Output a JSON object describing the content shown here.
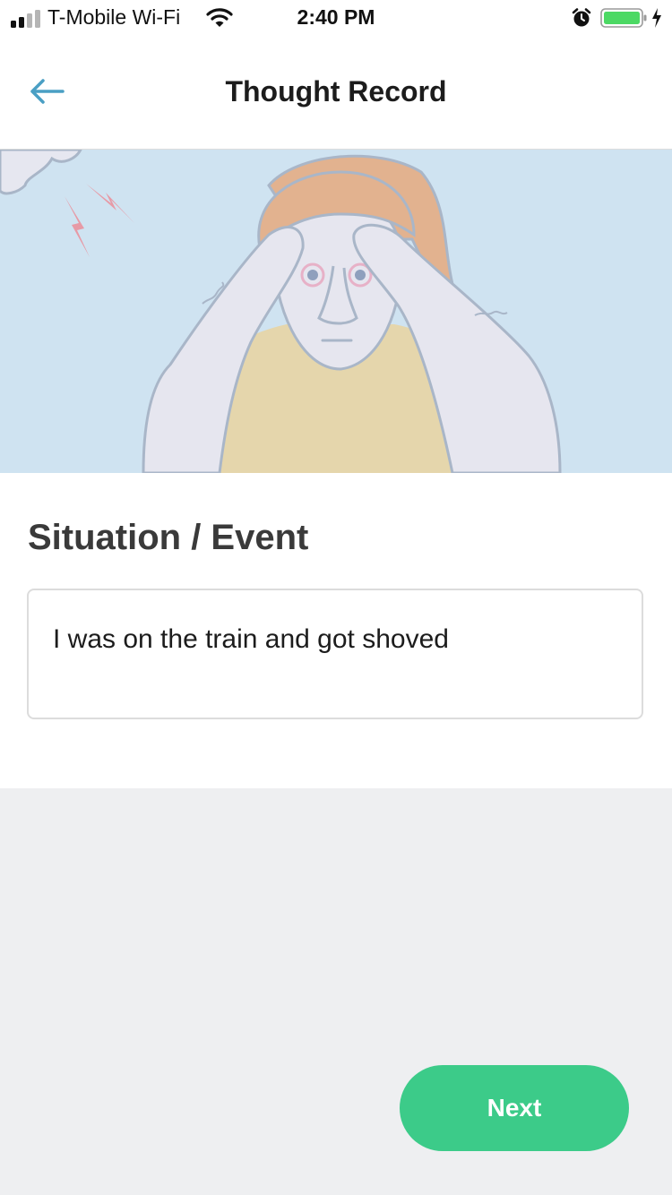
{
  "status_bar": {
    "carrier": "T-Mobile Wi-Fi",
    "time": "2:40 PM",
    "signal_icon": "signal-bars-icon",
    "wifi_icon": "wifi-icon",
    "alarm_icon": "alarm-clock-icon",
    "battery_icon": "battery-charging-icon",
    "battery_color": "#4cd964"
  },
  "nav": {
    "title": "Thought Record",
    "back_icon": "arrow-left-icon",
    "back_color": "#4a9fc4"
  },
  "hero": {
    "illustration": "stressed-person-illustration",
    "background_color": "#cfe3f1"
  },
  "form": {
    "label": "Situation / Event",
    "value": "I was on the train and got shoved"
  },
  "footer": {
    "next_label": "Next",
    "next_color": "#3ccb89"
  }
}
